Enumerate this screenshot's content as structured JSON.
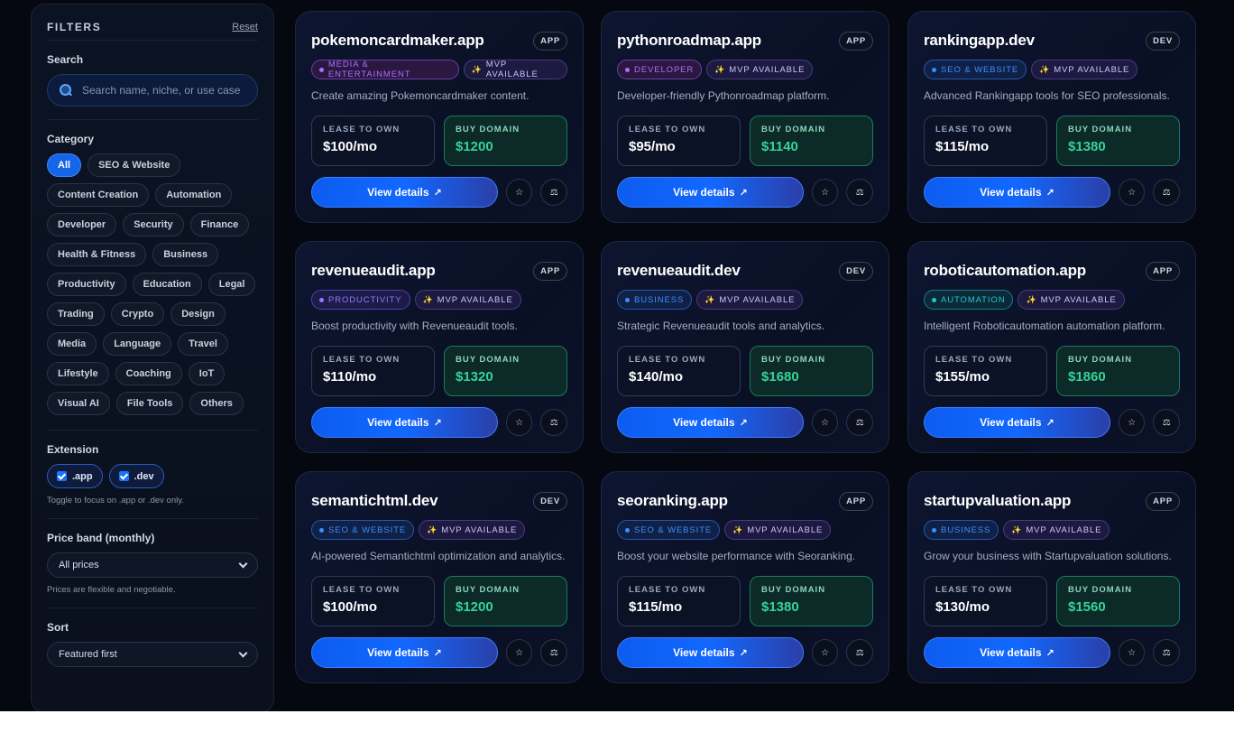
{
  "filters": {
    "title": "FILTERS",
    "reset": "Reset",
    "search_label": "Search",
    "search_placeholder": "Search name, niche, or use case",
    "category_label": "Category",
    "categories": [
      {
        "label": "All",
        "active": true
      },
      {
        "label": "SEO & Website"
      },
      {
        "label": "Content Creation"
      },
      {
        "label": "Automation"
      },
      {
        "label": "Developer"
      },
      {
        "label": "Security"
      },
      {
        "label": "Finance"
      },
      {
        "label": "Health & Fitness"
      },
      {
        "label": "Business"
      },
      {
        "label": "Productivity"
      },
      {
        "label": "Education"
      },
      {
        "label": "Legal"
      },
      {
        "label": "Trading"
      },
      {
        "label": "Crypto"
      },
      {
        "label": "Design"
      },
      {
        "label": "Media"
      },
      {
        "label": "Language"
      },
      {
        "label": "Travel"
      },
      {
        "label": "Lifestyle"
      },
      {
        "label": "Coaching"
      },
      {
        "label": "IoT"
      },
      {
        "label": "Visual AI"
      },
      {
        "label": "File Tools"
      },
      {
        "label": "Others"
      }
    ],
    "extension_label": "Extension",
    "extensions": [
      ".app",
      ".dev"
    ],
    "extension_hint": "Toggle to focus on .app or .dev only.",
    "price_label": "Price band (monthly)",
    "price_value": "All prices",
    "price_hint": "Prices are flexible and negotiable.",
    "sort_label": "Sort",
    "sort_value": "Featured first"
  },
  "labels": {
    "lease": "LEASE TO OWN",
    "buy": "BUY DOMAIN",
    "mvp": "MVP AVAILABLE",
    "view": "View details",
    "arrow_glyph": "↗",
    "spark_glyph": "✨",
    "star_glyph": "☆",
    "compare_glyph": "⚖"
  },
  "cards": [
    {
      "name": "pokemoncardmaker.app",
      "ext": "APP",
      "category": "MEDIA & ENTERTAINMENT",
      "cat_color": "#b06bff",
      "cat_bg": "#2a1840",
      "cat_border": "#6a3ea8",
      "desc": "Create amazing Pokemoncardmaker content.",
      "lease": "$100/mo",
      "buy": "$1200"
    },
    {
      "name": "pythonroadmap.app",
      "ext": "APP",
      "category": "DEVELOPER",
      "cat_color": "#b06bff",
      "cat_bg": "#2a1840",
      "cat_border": "#6a3ea8",
      "desc": "Developer-friendly Pythonroadmap platform.",
      "lease": "$95/mo",
      "buy": "$1140"
    },
    {
      "name": "rankingapp.dev",
      "ext": "DEV",
      "category": "SEO & WEBSITE",
      "cat_color": "#3f8cff",
      "cat_bg": "#0f2147",
      "cat_border": "#2a55a8",
      "desc": "Advanced Rankingapp tools for SEO professionals.",
      "lease": "$115/mo",
      "buy": "$1380"
    },
    {
      "name": "revenueaudit.app",
      "ext": "APP",
      "category": "PRODUCTIVITY",
      "cat_color": "#8b7bff",
      "cat_bg": "#1f1b48",
      "cat_border": "#4a43a8",
      "desc": "Boost productivity with Revenueaudit tools.",
      "lease": "$110/mo",
      "buy": "$1320"
    },
    {
      "name": "revenueaudit.dev",
      "ext": "DEV",
      "category": "BUSINESS",
      "cat_color": "#3f8cff",
      "cat_bg": "#0f2147",
      "cat_border": "#2a55a8",
      "desc": "Strategic Revenueaudit tools and analytics.",
      "lease": "$140/mo",
      "buy": "$1680"
    },
    {
      "name": "roboticautomation.app",
      "ext": "APP",
      "category": "AUTOMATION",
      "cat_color": "#22c4d6",
      "cat_bg": "#0c2a36",
      "cat_border": "#1b7a8a",
      "desc": "Intelligent Roboticautomation automation platform.",
      "lease": "$155/mo",
      "buy": "$1860"
    },
    {
      "name": "semantichtml.dev",
      "ext": "DEV",
      "category": "SEO & WEBSITE",
      "cat_color": "#3f8cff",
      "cat_bg": "#0f2147",
      "cat_border": "#2a55a8",
      "desc": "AI-powered Semantichtml optimization and analytics.",
      "lease": "$100/mo",
      "buy": "$1200"
    },
    {
      "name": "seoranking.app",
      "ext": "APP",
      "category": "SEO & WEBSITE",
      "cat_color": "#3f8cff",
      "cat_bg": "#0f2147",
      "cat_border": "#2a55a8",
      "desc": "Boost your website performance with Seoranking.",
      "lease": "$115/mo",
      "buy": "$1380"
    },
    {
      "name": "startupvaluation.app",
      "ext": "APP",
      "category": "BUSINESS",
      "cat_color": "#3f8cff",
      "cat_bg": "#0f2147",
      "cat_border": "#2a55a8",
      "desc": "Grow your business with Startupvaluation solutions.",
      "lease": "$130/mo",
      "buy": "$1560"
    }
  ]
}
